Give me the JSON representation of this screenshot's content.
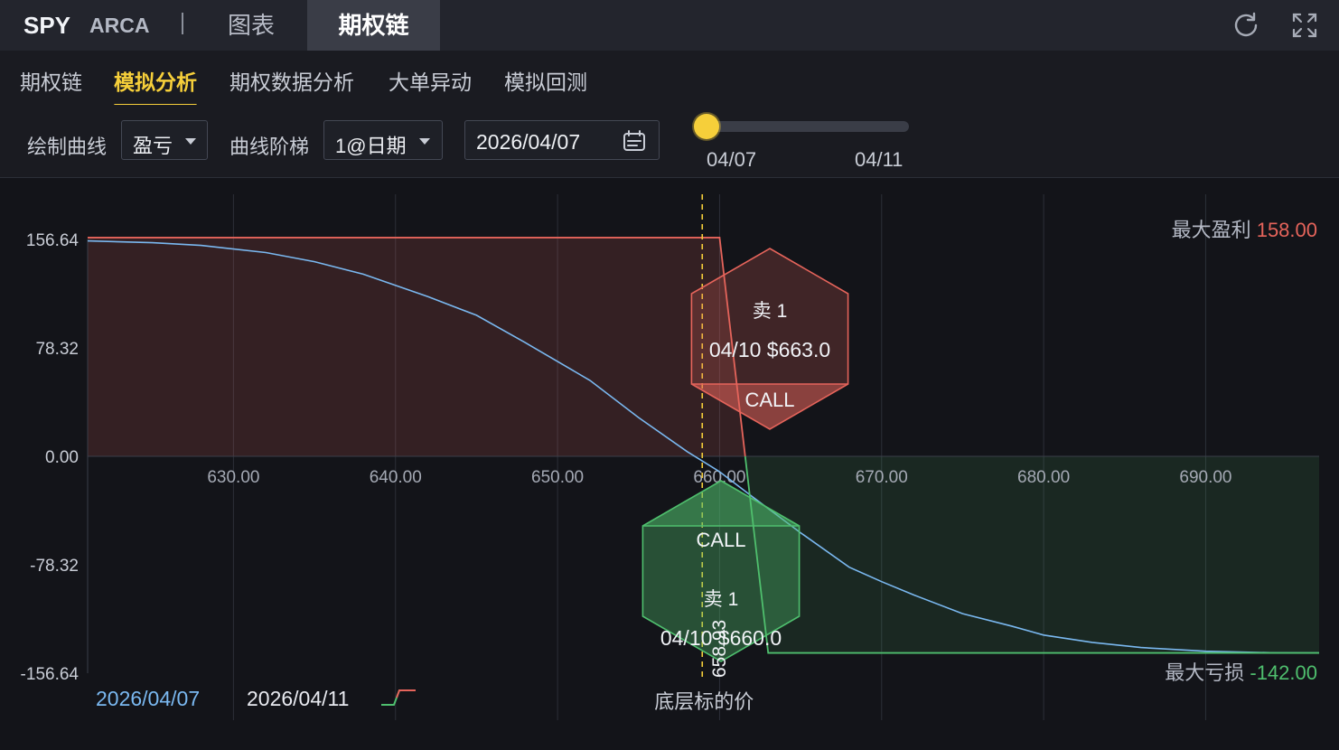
{
  "header": {
    "ticker": "SPY",
    "exchange": "ARCA",
    "tabs": [
      {
        "label": "图表",
        "active": false
      },
      {
        "label": "期权链",
        "active": true
      }
    ],
    "icons": [
      "refresh-icon",
      "fullscreen-icon"
    ]
  },
  "subnav": {
    "tabs": [
      {
        "label": "期权链",
        "active": false
      },
      {
        "label": "模拟分析",
        "active": true
      },
      {
        "label": "期权数据分析",
        "active": false
      },
      {
        "label": "大单异动",
        "active": false
      },
      {
        "label": "模拟回测",
        "active": false
      }
    ]
  },
  "controls": {
    "curve_label": "绘制曲线",
    "curve_value": "盈亏",
    "ladder_label": "曲线阶梯",
    "ladder_value": "1@日期",
    "date_value": "2026/04/07",
    "slider": {
      "start": "04/07",
      "end": "04/11",
      "position": 0
    }
  },
  "colors": {
    "accent": "#f6cf3a",
    "profit": "#e5645b",
    "loss": "#4fbf6e",
    "current_curve": "#7ab8f0"
  },
  "chart_data": {
    "type": "line",
    "xlim": [
      621,
      697
    ],
    "ylim": [
      -156.64,
      156.64
    ],
    "x_ticks": [
      630,
      640,
      650,
      660,
      670,
      680,
      690
    ],
    "x_tick_labels": [
      "630.00",
      "640.00",
      "650.00",
      "660.00",
      "670.00",
      "680.00",
      "690.00"
    ],
    "y_ticks": [
      156.64,
      78.32,
      0,
      -78.32,
      -156.64
    ],
    "y_tick_labels": [
      "156.64",
      "78.32",
      "0.00",
      "-78.32",
      "-156.64"
    ],
    "series": [
      {
        "name": "2026/04/07",
        "color": "#7ab8f0",
        "x": [
          621,
          625,
          628,
          632,
          635,
          638,
          642,
          645,
          648,
          652,
          655,
          658,
          660,
          662,
          665,
          668,
          670,
          672,
          675,
          678,
          680,
          683,
          686,
          690,
          694,
          697
        ],
        "y": [
          155.6,
          154.3,
          152.3,
          147.2,
          140.6,
          131.6,
          115.3,
          101.9,
          82.2,
          54.8,
          28.0,
          3.4,
          -11.1,
          -29.0,
          -55.2,
          -80.1,
          -90.5,
          -100.2,
          -113.6,
          -122.6,
          -129.1,
          -134.4,
          -138.1,
          -140.8,
          -141.8,
          -142.0
        ]
      },
      {
        "name": "2026/04/11",
        "color_segments": [
          "#4fbf6e",
          "#e5645b"
        ],
        "x": [
          621,
          660,
          663,
          697
        ],
        "y": [
          158.0,
          158.0,
          -142.0,
          -142.0
        ]
      }
    ],
    "max_profit_label": "最大盈利",
    "max_profit_value": "158.00",
    "max_loss_label": "最大亏损",
    "max_loss_value": "-142.00",
    "underlying_price": 658.93,
    "underlying_price_label": "658.93",
    "underlying_axis_label": "底层标的价",
    "legs": [
      {
        "side": "卖 1",
        "detail": "04/10 $663.0",
        "type": "CALL",
        "strike": 663,
        "color": "#e5645b",
        "position": "upper"
      },
      {
        "side": "卖 1",
        "detail": "04/10 $660.0",
        "type": "CALL",
        "strike": 660,
        "color": "#4fbf6e",
        "position": "lower"
      }
    ],
    "legend": [
      {
        "label": "2026/04/07",
        "color": "#7ab8f0"
      },
      {
        "label": "2026/04/11",
        "color": "#e8eaf0"
      }
    ]
  }
}
